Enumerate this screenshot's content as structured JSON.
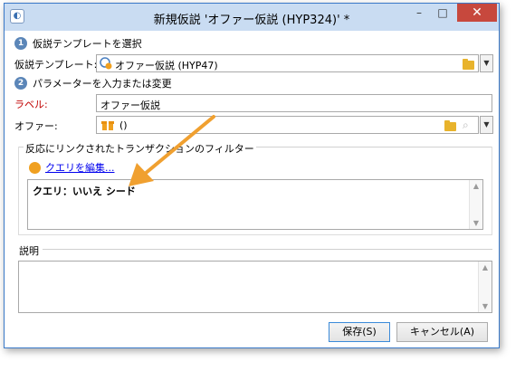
{
  "window": {
    "title": "新規仮説 'オファー仮説 (HYP324)' *",
    "minimize": "–",
    "maximize": "□",
    "close": "✕"
  },
  "step1": {
    "num": "1",
    "label": "仮説テンプレートを選択"
  },
  "template": {
    "label": "仮説テンプレート:",
    "value": "オファー仮説 (HYP47)"
  },
  "step2": {
    "num": "2",
    "label": "パラメーターを入力または変更"
  },
  "label_field": {
    "label": "ラベル:",
    "value": "オファー仮説"
  },
  "offer_field": {
    "label": "オファー:",
    "value": "()"
  },
  "filter_group": {
    "title": "反応にリンクされたトランザクションのフィルター",
    "edit_link": "クエリを編集...",
    "query_text": "クエリ：いいえ シード"
  },
  "description": {
    "label": "説明",
    "value": ""
  },
  "buttons": {
    "save": "保存(S)",
    "cancel": "キャンセル(A)"
  },
  "colors": {
    "accent": "#3a79c8",
    "arrow": "#f0a030",
    "close_button": "#c7483d"
  },
  "icons": [
    "app-icon",
    "template-icon",
    "offer-gift-icon",
    "folder-icon",
    "search-icon",
    "dropdown-icon",
    "edit-query-icon"
  ]
}
